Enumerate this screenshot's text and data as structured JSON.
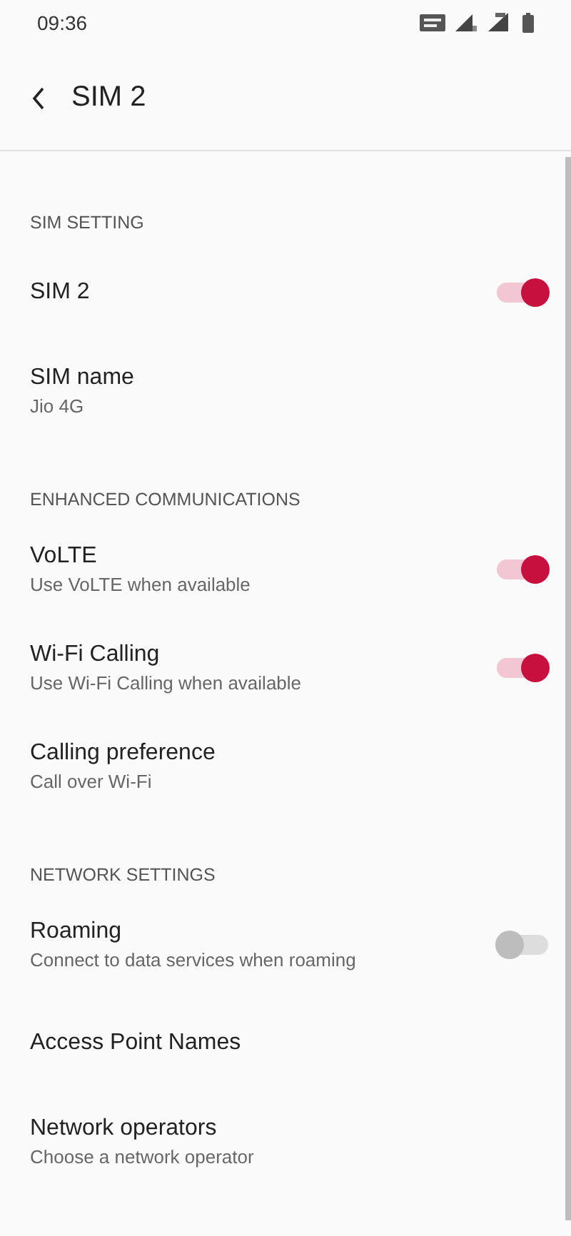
{
  "status_bar": {
    "time": "09:36"
  },
  "toolbar": {
    "title": "SIM 2"
  },
  "sections": [
    {
      "header": "SIM SETTING",
      "items": [
        {
          "kind": "switch",
          "title": "SIM 2",
          "on": true
        },
        {
          "kind": "text",
          "title": "SIM name",
          "subtitle": "Jio 4G"
        }
      ]
    },
    {
      "header": "ENHANCED COMMUNICATIONS",
      "items": [
        {
          "kind": "switch",
          "title": "VoLTE",
          "subtitle": "Use VoLTE when available",
          "on": true
        },
        {
          "kind": "switch",
          "title": "Wi-Fi Calling",
          "subtitle": "Use Wi-Fi Calling when available",
          "on": true
        },
        {
          "kind": "text",
          "title": "Calling preference",
          "subtitle": "Call over Wi-Fi"
        }
      ]
    },
    {
      "header": "NETWORK SETTINGS",
      "items": [
        {
          "kind": "switch",
          "title": "Roaming",
          "subtitle": "Connect to data services when roaming",
          "on": false
        },
        {
          "kind": "text",
          "title": "Access Point Names"
        },
        {
          "kind": "text",
          "title": "Network operators",
          "subtitle": "Choose a network operator"
        }
      ]
    }
  ]
}
